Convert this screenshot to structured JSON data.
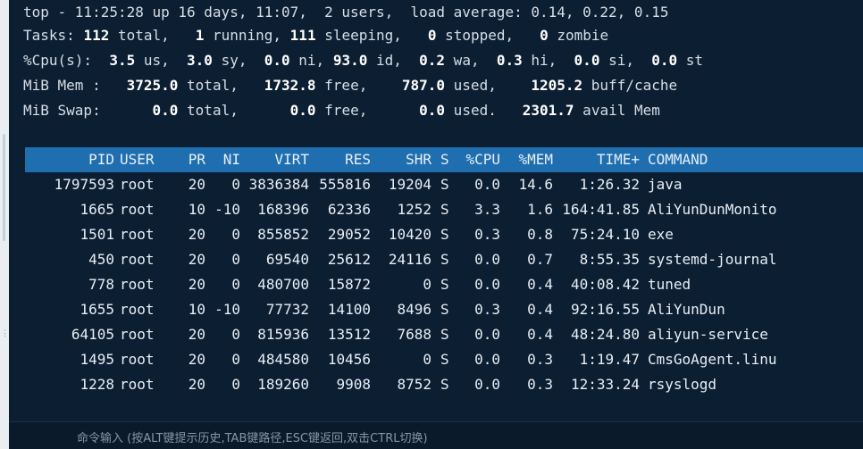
{
  "summary": {
    "line1_prefix": "top - 11:25:28 up 16 days, 11:07,  2 users,  load average: 0.14, 0.22, 0.15",
    "tasks": {
      "label": "Tasks:",
      "total": "112",
      "total_label": " total,",
      "running": "1",
      "running_label": " running,",
      "sleeping": "111",
      "sleeping_label": " sleeping,",
      "stopped": "0",
      "stopped_label": " stopped,",
      "zombie": "0",
      "zombie_label": " zombie"
    },
    "cpu": {
      "label": "%Cpu(s):",
      "us": "3.5",
      "sy": "3.0",
      "ni": "0.0",
      "id": "93.0",
      "wa": "0.2",
      "hi": "0.3",
      "si": "0.0",
      "st": "0.0"
    },
    "mem": {
      "label": "MiB Mem :",
      "total": "3725.0",
      "free": "1732.8",
      "used": "787.0",
      "buff": "1205.2"
    },
    "swap": {
      "label": "MiB Swap:",
      "total": "0.0",
      "free": "0.0",
      "used": "0.0",
      "avail": "2301.7"
    }
  },
  "table": {
    "headers": [
      "PID",
      "USER",
      "PR",
      "NI",
      "VIRT",
      "RES",
      "SHR",
      "S",
      "%CPU",
      "%MEM",
      "TIME+",
      "COMMAND"
    ],
    "rows": [
      [
        "1797593",
        "root",
        "20",
        "0",
        "3836384",
        "555816",
        "19204",
        "S",
        "0.0",
        "14.6",
        "1:26.32",
        "java"
      ],
      [
        "1665",
        "root",
        "10",
        "-10",
        "168396",
        "62336",
        "1252",
        "S",
        "3.3",
        "1.6",
        "164:41.85",
        "AliYunDunMonito"
      ],
      [
        "1501",
        "root",
        "20",
        "0",
        "855852",
        "29052",
        "10420",
        "S",
        "0.3",
        "0.8",
        "75:24.10",
        "exe"
      ],
      [
        "450",
        "root",
        "20",
        "0",
        "69540",
        "25612",
        "24116",
        "S",
        "0.0",
        "0.7",
        "8:55.35",
        "systemd-journal"
      ],
      [
        "778",
        "root",
        "20",
        "0",
        "480700",
        "15872",
        "0",
        "S",
        "0.0",
        "0.4",
        "40:08.42",
        "tuned"
      ],
      [
        "1655",
        "root",
        "10",
        "-10",
        "77732",
        "14100",
        "8496",
        "S",
        "0.3",
        "0.4",
        "92:16.55",
        "AliYunDun"
      ],
      [
        "64105",
        "root",
        "20",
        "0",
        "815936",
        "13512",
        "7688",
        "S",
        "0.0",
        "0.4",
        "48:24.80",
        "aliyun-service"
      ],
      [
        "1495",
        "root",
        "20",
        "0",
        "484580",
        "10456",
        "0",
        "S",
        "0.0",
        "0.3",
        "1:19.47",
        "CmsGoAgent.linu"
      ],
      [
        "1228",
        "root",
        "20",
        "0",
        "189260",
        "9908",
        "8752",
        "S",
        "0.0",
        "0.3",
        "12:33.24",
        "rsyslogd"
      ]
    ]
  },
  "command_bar": {
    "hint": "命令输入 (按ALT键提示历史,TAB键路径,ESC键返回,双击CTRL切换)"
  },
  "colors": {
    "background": "#0c1e31",
    "header_bar": "#1f6fb0",
    "text": "#d6dee7"
  }
}
